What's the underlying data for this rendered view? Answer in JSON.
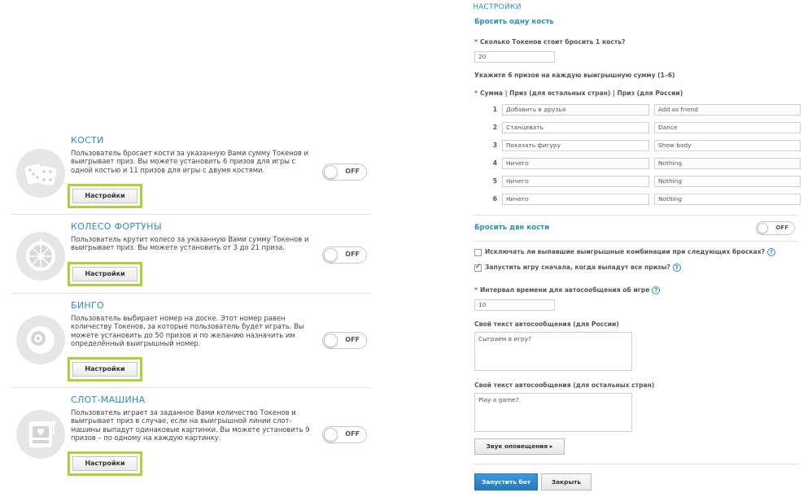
{
  "games": [
    {
      "title": "КОСТИ",
      "description": "Пользователь бросает кости за указанную Вами сумму Токенов и выигрывает приз. Вы можете установить 6 призов для игры с одной костью и 11 призов для игры с двумя костями.",
      "toggle": "OFF",
      "settings_label": "Настройки",
      "icon": "dice-icon"
    },
    {
      "title": "КОЛЕСО ФОРТУНЫ",
      "description": "Пользователь крутит колесо за указанную Вами сумму Токенов и выигрывает приз. Вы можете установить от 3 до 21 приза.",
      "toggle": "OFF",
      "settings_label": "Настройки",
      "icon": "wheel-icon"
    },
    {
      "title": "БИНГО",
      "description": "Пользователь выбирает номер на доске. Этот номер равен количеству Токенов, за которые пользователь будет играть. Вы можете установить до 50 призов и по желанию назначить им определённый выигрышный номер.",
      "toggle": "OFF",
      "settings_label": "Настройки",
      "icon": "bingo-ball-icon"
    },
    {
      "title": "СЛОТ-МАШИНА",
      "description": "Пользователь играет за заданное Вами количество Токенов и выигрывает приз в случае, если на выигрышной линии слот-машины выпадут одинаковые картинки. Вы можете установить 9 призов – по одному на каждую картинку.",
      "toggle": "OFF",
      "settings_label": "Настройки",
      "icon": "slot-machine-icon"
    }
  ],
  "settings": {
    "heading": "НАСТРОЙКИ",
    "one_die_title": "Бросить одну кость",
    "tokens_label": "Сколько Токенов стоит бросить 1 кость?",
    "tokens_value": "20",
    "prizes_hint": "Укажите 6 призов на каждую выигрышную сумму (1–6)",
    "columns_label": "Сумма | Приз (для остальных стран) | Приз (для России)",
    "prizes": [
      {
        "num": "1",
        "other": "Добавить в друзья",
        "russia": "Add as friend"
      },
      {
        "num": "2",
        "other": "Станцевать",
        "russia": "Dance"
      },
      {
        "num": "3",
        "other": "Показать фигуру",
        "russia": "Show body"
      },
      {
        "num": "4",
        "other": "Ничего",
        "russia": "Nothing"
      },
      {
        "num": "5",
        "other": "Ничего",
        "russia": "Nothing"
      },
      {
        "num": "6",
        "other": "Ничего",
        "russia": "Nothing"
      }
    ],
    "two_dice_title": "Бросить две кости",
    "two_dice_toggle": "OFF",
    "exclude_label": "Исключать ли выпавшие выигрышные комбинации при следующих бросках?",
    "restart_label": "Запустить игру сначала, когда выпадут все призы?",
    "interval_label": "Интервал времени для автосообщения об игре",
    "interval_value": "10",
    "msg_russia_label": "Свой текст автосообщения (для России)",
    "msg_russia_value": "Сыграем в игру?",
    "msg_other_label": "Свой текст автосообщения (для остальных стран)",
    "msg_other_value": "Play a game?",
    "sound_label": "Звук оповещения ▸",
    "start_label": "Запустить бот",
    "close_label": "Закрыть",
    "req_mark": "*",
    "help_mark": "?"
  },
  "colors": {
    "accent": "#2a8fbd",
    "highlight": "#a8d43a",
    "primary_button": "#2479be"
  }
}
